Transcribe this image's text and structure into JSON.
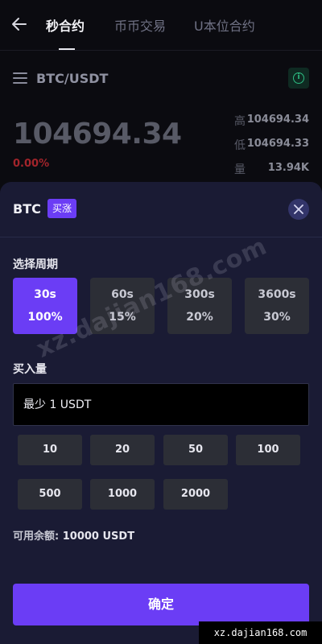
{
  "nav": {
    "tabs": [
      {
        "label": "秒合约",
        "active": true
      },
      {
        "label": "币币交易",
        "active": false
      },
      {
        "label": "U本位合约",
        "active": false
      }
    ]
  },
  "market": {
    "pair": "BTC/USDT",
    "price": "104694.34",
    "change": "0.00%",
    "stats": [
      {
        "label": "高",
        "value": "104694.34"
      },
      {
        "label": "低",
        "value": "104694.33"
      },
      {
        "label": "量",
        "value": "13.94K"
      }
    ]
  },
  "sheet": {
    "title": "BTC",
    "badge": "买涨",
    "period_label": "选择周期",
    "periods": [
      {
        "time": "30s",
        "rate": "100%",
        "selected": true
      },
      {
        "time": "60s",
        "rate": "15%",
        "selected": false
      },
      {
        "time": "300s",
        "rate": "20%",
        "selected": false
      },
      {
        "time": "3600s",
        "rate": "30%",
        "selected": false
      }
    ],
    "amount_label": "买入量",
    "amount_placeholder": "最少 1 USDT",
    "quick_amounts": [
      "10",
      "20",
      "50",
      "100",
      "500",
      "1000",
      "2000"
    ],
    "balance_label": "可用余额:",
    "balance_value": "10000 USDT",
    "confirm_label": "确定"
  },
  "watermark": {
    "text": "xz.dajian168.com",
    "diag": "xz.dajian168.com"
  },
  "colors": {
    "accent": "#6b3df5",
    "sheet_bg": "#1a1b34",
    "page_bg": "#0b0b10",
    "down": "#a3242b",
    "info_green": "#2dbd83"
  }
}
